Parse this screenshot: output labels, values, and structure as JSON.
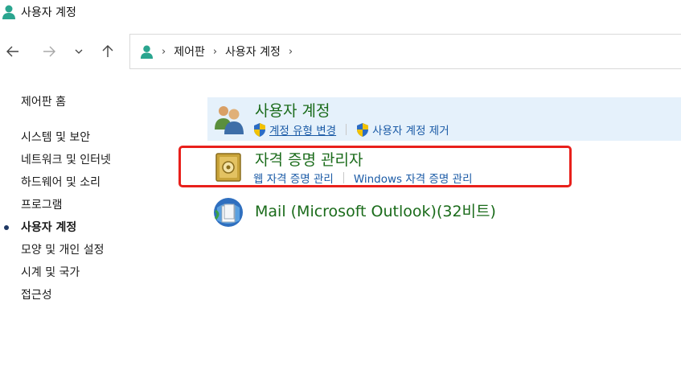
{
  "window": {
    "title": "사용자 계정"
  },
  "nav": {
    "back_icon": "back-arrow-icon",
    "forward_icon": "forward-arrow-icon",
    "recent_icon": "chevron-down-icon",
    "up_icon": "up-arrow-icon"
  },
  "address": {
    "segments": [
      "제어판",
      "사용자 계정"
    ]
  },
  "sidebar": {
    "home": "제어판 홈",
    "items": [
      {
        "label": "시스템 및 보안"
      },
      {
        "label": "네트워크 및 인터넷"
      },
      {
        "label": "하드웨어 및 소리"
      },
      {
        "label": "프로그램"
      },
      {
        "label": "사용자 계정"
      },
      {
        "label": "모양 및 개인 설정"
      },
      {
        "label": "시계 및 국가"
      },
      {
        "label": "접근성"
      }
    ],
    "active_index": 4
  },
  "categories": {
    "users": {
      "title": "사용자 계정",
      "links": [
        "계정 유형 변경",
        "사용자 계정 제거"
      ]
    },
    "credentials": {
      "title": "자격 증명 관리자",
      "links": [
        "웹 자격 증명 관리",
        "Windows 자격 증명 관리"
      ]
    },
    "mail": {
      "title": "Mail (Microsoft Outlook)(32비트)"
    }
  },
  "colors": {
    "title_green": "#1a6b1a",
    "link_blue": "#1a5aa6",
    "hover_bg": "#e5f1fb",
    "highlight_red": "#e8201b"
  }
}
